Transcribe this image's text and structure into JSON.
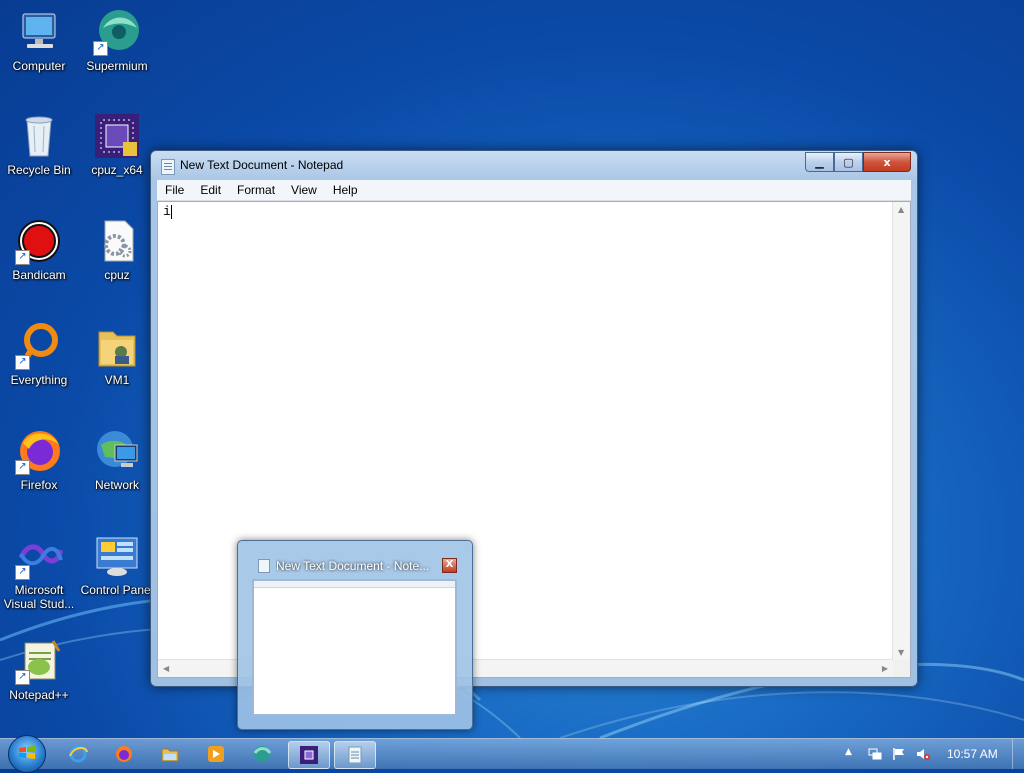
{
  "desktop": {
    "icons": [
      {
        "label": "Computer",
        "icon": "computer-icon"
      },
      {
        "label": "Supermium",
        "icon": "supermium-icon"
      },
      {
        "label": "Recycle Bin",
        "icon": "recycle-bin-icon"
      },
      {
        "label": "cpuz_x64",
        "icon": "cpuz-x64-icon"
      },
      {
        "label": "Bandicam",
        "icon": "bandicam-icon"
      },
      {
        "label": "cpuz",
        "icon": "cpuz-icon"
      },
      {
        "label": "Everything",
        "icon": "everything-icon"
      },
      {
        "label": "VM1",
        "icon": "vm1-folder-icon"
      },
      {
        "label": "Firefox",
        "icon": "firefox-icon"
      },
      {
        "label": "Network",
        "icon": "network-icon"
      },
      {
        "label": "Microsoft Visual Stud...",
        "icon": "visual-studio-icon"
      },
      {
        "label": "Control Panel",
        "icon": "control-panel-icon"
      },
      {
        "label": "Notepad++",
        "icon": "notepad-plus-plus-icon"
      }
    ]
  },
  "notepad": {
    "title": "New Text Document - Notepad",
    "menu": {
      "file": "File",
      "edit": "Edit",
      "format": "Format",
      "view": "View",
      "help": "Help"
    },
    "content": "i",
    "close_symbol": "x"
  },
  "preview": {
    "title": "New Text Document - Note...",
    "close_symbol": "X"
  },
  "taskbar": {
    "clock": "10:57 AM",
    "apps": [
      "internet-explorer-icon",
      "firefox-icon",
      "file-explorer-icon",
      "media-player-icon",
      "supermium-icon",
      "cpuz-icon",
      "notepad-icon"
    ]
  },
  "colors": {
    "desktop_bg": "#1666c0",
    "close_red": "#c23b22"
  }
}
